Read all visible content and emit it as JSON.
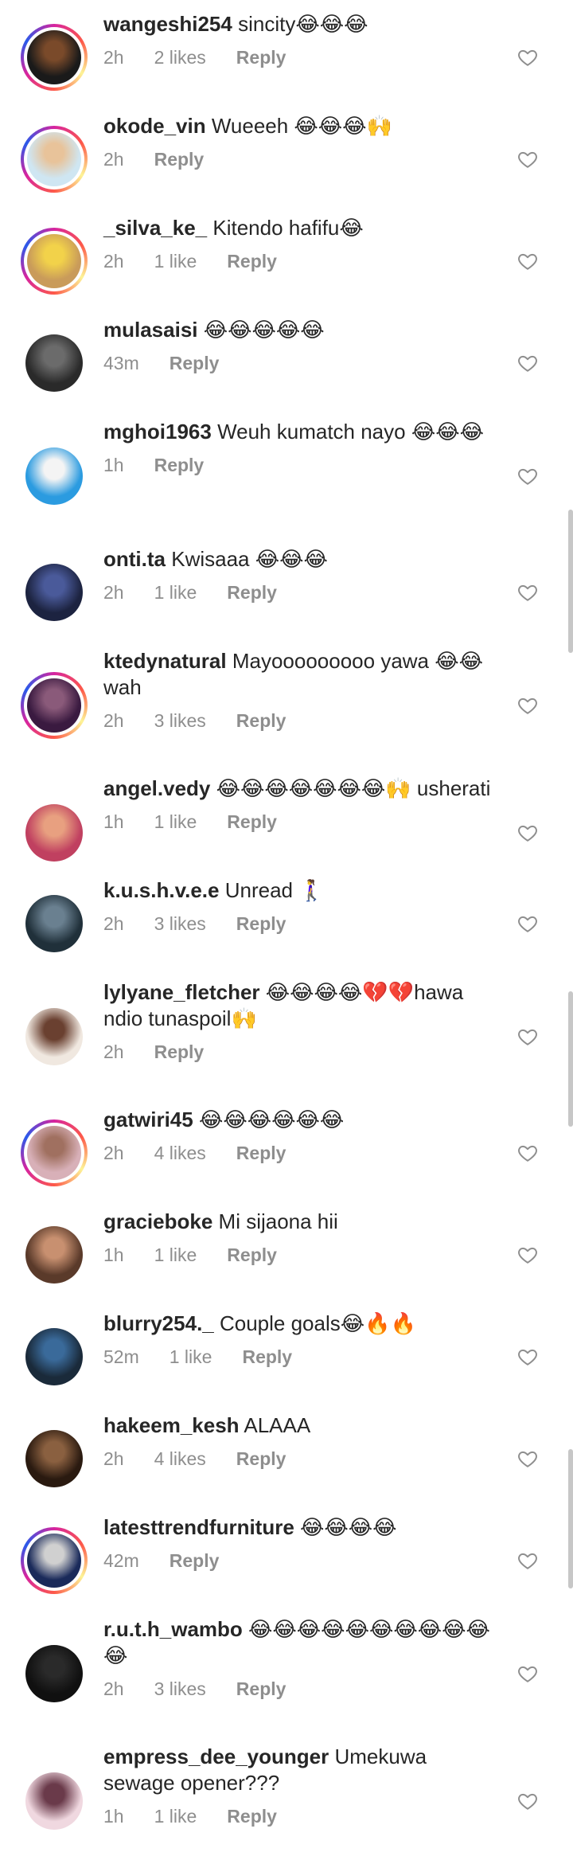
{
  "comments": [
    {
      "username": "wangeshi254",
      "text": "sincity😂😂😂",
      "time": "2h",
      "likes": "2 likes",
      "reply": "Reply",
      "story": true,
      "avatar": [
        "#1a1a1a",
        "#7a4a2a"
      ]
    },
    {
      "username": "okode_vin",
      "text": "Wueeeh 😂😂😂🙌",
      "time": "2h",
      "likes": "",
      "reply": "Reply",
      "story": true,
      "avatar": [
        "#cfe6f2",
        "#e8c39a"
      ]
    },
    {
      "username": "_silva_ke_",
      "text": "Kitendo hafifu😂",
      "time": "2h",
      "likes": "1 like",
      "reply": "Reply",
      "story": true,
      "avatar": [
        "#c99b5a",
        "#f2d24a"
      ]
    },
    {
      "username": "mulasaisi",
      "text": "😂😂😂😂😂",
      "time": "43m",
      "likes": "",
      "reply": "Reply",
      "story": false,
      "avatar": [
        "#2a2a2a",
        "#6b6b6b"
      ]
    },
    {
      "username": "mghoi1963",
      "text": "Weuh kumatch nayo 😂😂😂",
      "time": "1h",
      "likes": "",
      "reply": "Reply",
      "story": false,
      "avatar": [
        "#2b9be0",
        "#f4f4f4"
      ]
    },
    {
      "username": "onti.ta",
      "text": "Kwisaaa 😂😂😂",
      "time": "2h",
      "likes": "1 like",
      "reply": "Reply",
      "story": false,
      "avatar": [
        "#1c2340",
        "#4a5a9a"
      ]
    },
    {
      "username": "ktedynatural",
      "text": "Mayooooooooo yawa 😂😂 wah",
      "time": "2h",
      "likes": "3 likes",
      "reply": "Reply",
      "story": true,
      "avatar": [
        "#3a1a40",
        "#8a5a7a"
      ]
    },
    {
      "username": "angel.vedy",
      "text": "😂😂😂😂😂😂😂🙌 usherati",
      "time": "1h",
      "likes": "1 like",
      "reply": "Reply",
      "story": false,
      "avatar": [
        "#c04060",
        "#e8a080"
      ]
    },
    {
      "username": "k.u.s.h.v.e.e",
      "text": "Unread 🚶‍♀️",
      "time": "2h",
      "likes": "3 likes",
      "reply": "Reply",
      "story": false,
      "avatar": [
        "#20303a",
        "#6a8090"
      ]
    },
    {
      "username": "lylyane_fletcher",
      "text": "😂😂😂😂💔💔hawa ndio tunaspoil🙌",
      "time": "2h",
      "likes": "",
      "reply": "Reply",
      "story": false,
      "avatar": [
        "#f0e8e0",
        "#6a4030"
      ]
    },
    {
      "username": "gatwiri45",
      "text": "😂😂😂😂😂😂",
      "time": "2h",
      "likes": "4 likes",
      "reply": "Reply",
      "story": true,
      "avatar": [
        "#d8b0b8",
        "#a07060"
      ]
    },
    {
      "username": "gracieboke",
      "text": "Mi sijaona hii",
      "time": "1h",
      "likes": "1 like",
      "reply": "Reply",
      "story": false,
      "avatar": [
        "#5a3a2a",
        "#c89070"
      ]
    },
    {
      "username": "blurry254._",
      "text": "Couple goals😂🔥🔥",
      "time": "52m",
      "likes": "1 like",
      "reply": "Reply",
      "story": false,
      "avatar": [
        "#1a2a3a",
        "#3a6a9a"
      ]
    },
    {
      "username": "hakeem_kesh",
      "text": "ALAAA",
      "time": "2h",
      "likes": "4 likes",
      "reply": "Reply",
      "story": false,
      "avatar": [
        "#2a1a10",
        "#8a6040"
      ]
    },
    {
      "username": "latesttrendfurniture",
      "text": "😂😂😂😂",
      "time": "42m",
      "likes": "",
      "reply": "Reply",
      "story": true,
      "avatar": [
        "#1a2a5a",
        "#d0d0d0"
      ]
    },
    {
      "username": "r.u.t.h_wambo",
      "text": "😂😂😂😂😂😂😂😂😂😂😂",
      "time": "2h",
      "likes": "3 likes",
      "reply": "Reply",
      "story": false,
      "avatar": [
        "#101010",
        "#2a2a2a"
      ]
    },
    {
      "username": "empress_dee_younger",
      "text": "Umekuwa sewage opener???",
      "time": "1h",
      "likes": "1 like",
      "reply": "Reply",
      "story": false,
      "avatar": [
        "#f0d8e0",
        "#6a3a4a"
      ]
    }
  ],
  "colors": {
    "text": "#262626",
    "meta": "#8e8e8e",
    "heart": "#8e8e8e",
    "scrollbar": "#c7c7c7"
  },
  "icons": {
    "heart": "heart-outline-icon"
  }
}
